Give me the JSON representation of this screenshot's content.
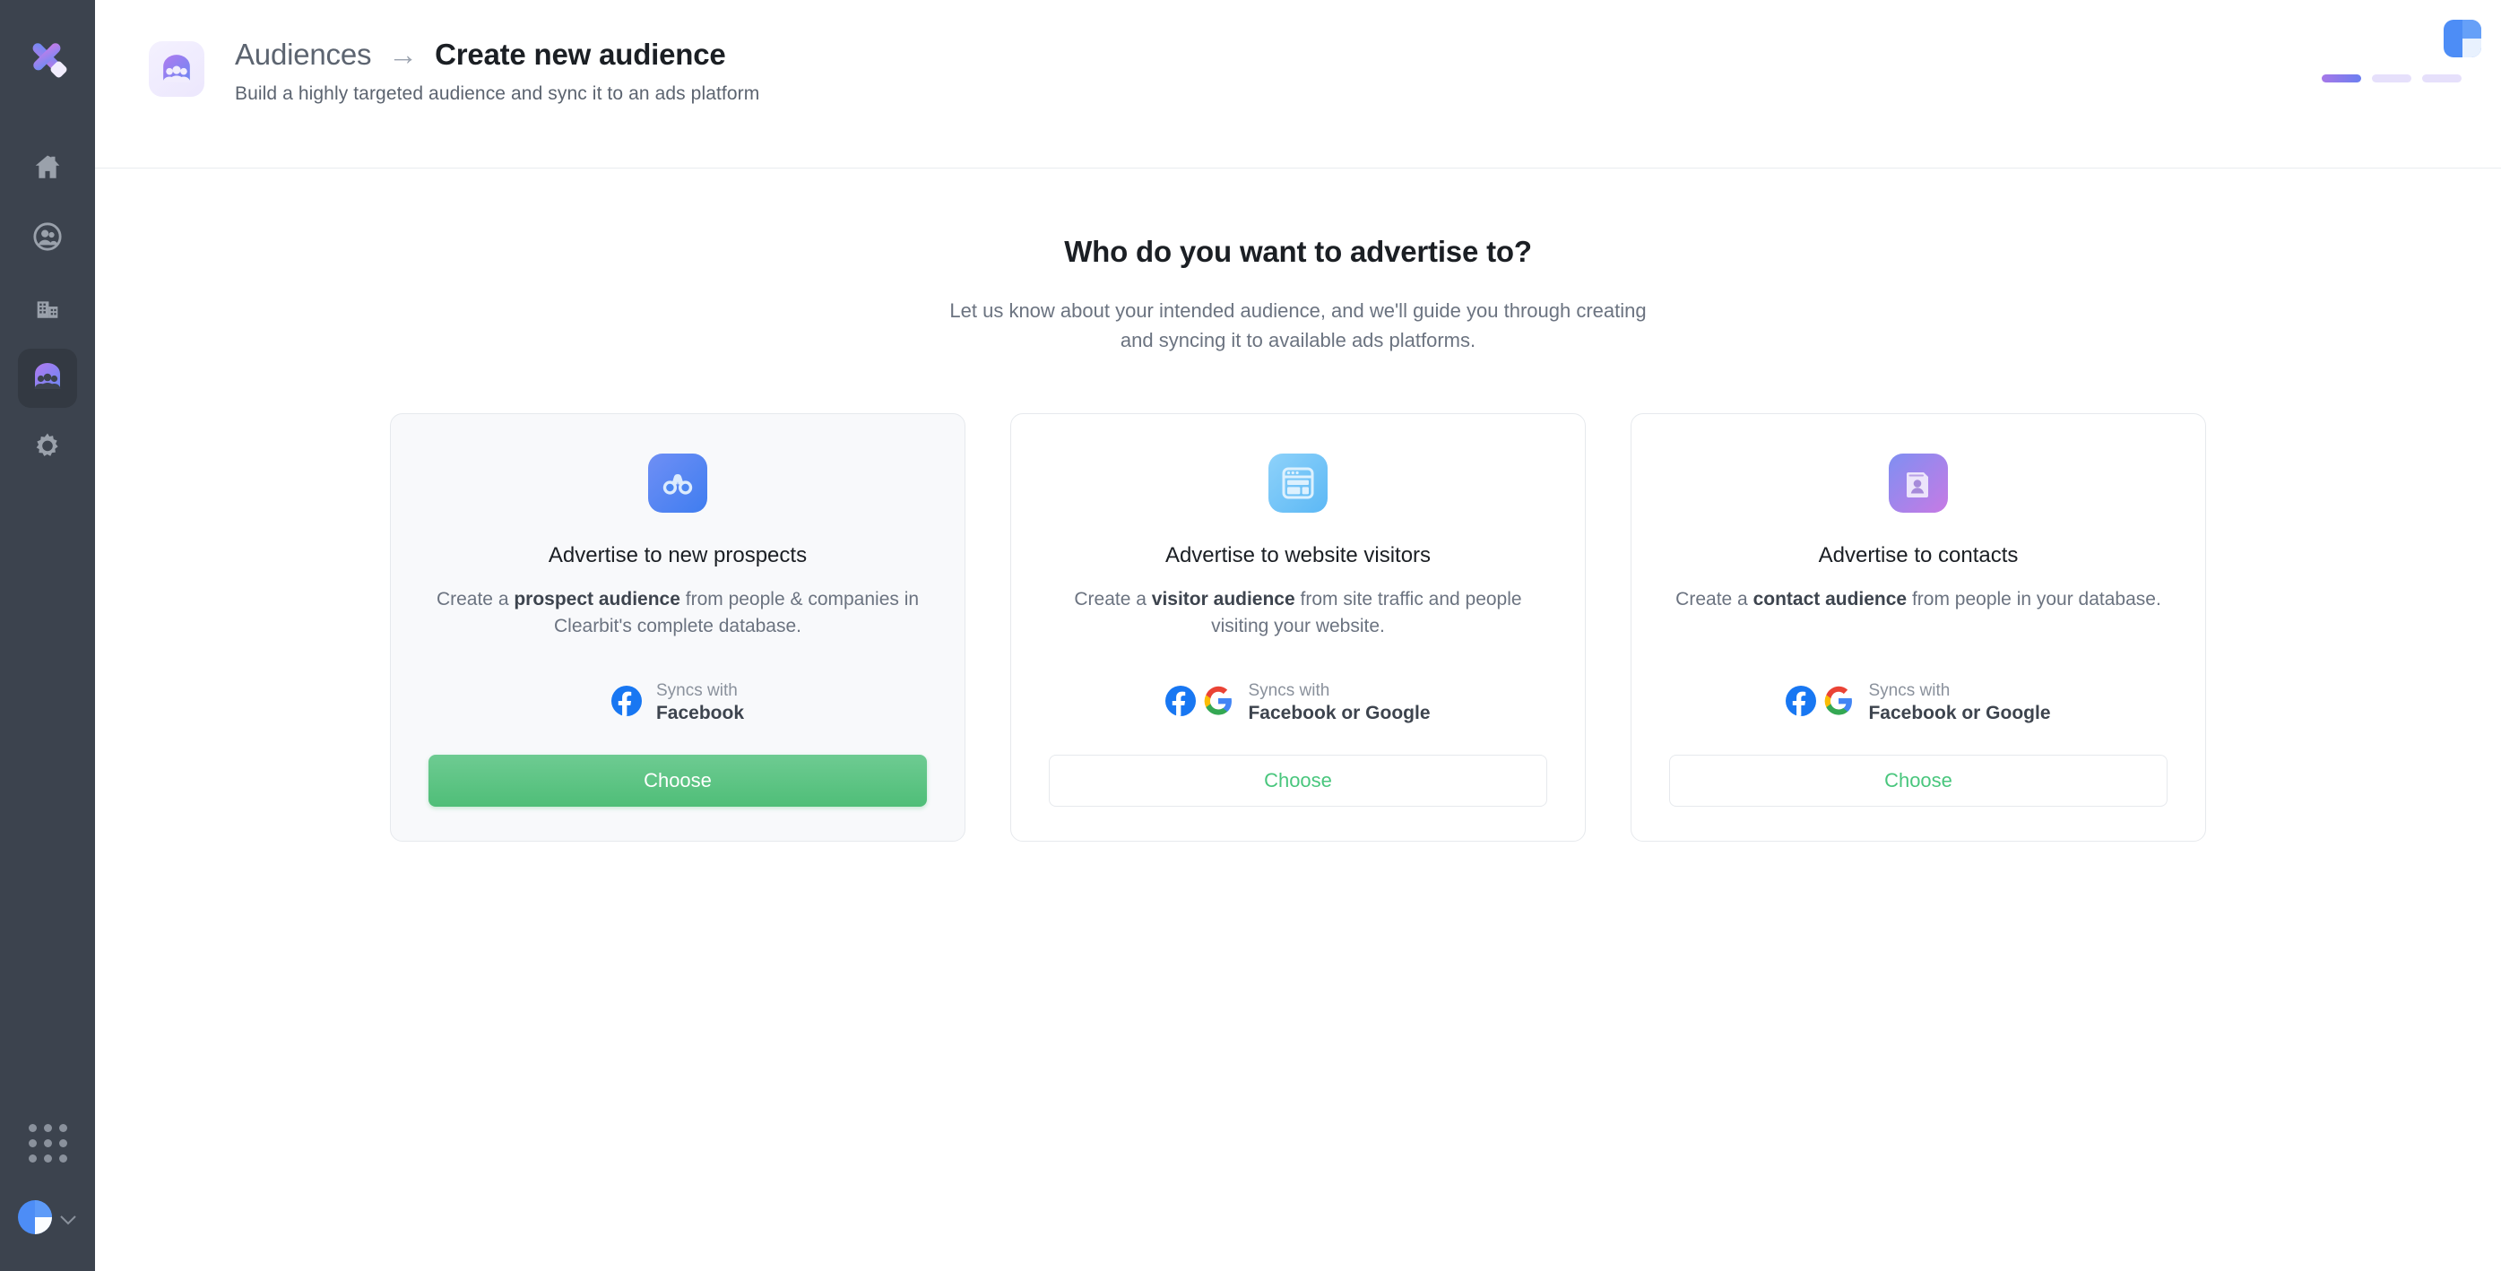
{
  "sidebar": {
    "logo_icon": "clearbit-x-logo",
    "items": [
      {
        "icon": "home-icon",
        "name": "home",
        "active": false
      },
      {
        "icon": "people-icon",
        "name": "people",
        "active": false
      },
      {
        "icon": "building-icon",
        "name": "companies",
        "active": false
      },
      {
        "icon": "audiences-icon",
        "name": "audiences",
        "active": true
      },
      {
        "icon": "gear-icon",
        "name": "settings",
        "active": false
      }
    ],
    "apps_icon": "apps-grid-icon",
    "account_icon": "user-avatar",
    "account_chevron": "chevron-down-icon"
  },
  "header": {
    "page_icon": "audiences-icon",
    "breadcrumb_parent": "Audiences",
    "breadcrumb_separator": "→",
    "breadcrumb_current": "Create new audience",
    "subtitle": "Build a highly targeted audience and sync it to an ads platform",
    "brand_mark": "clearbit-mark-icon",
    "progress": {
      "total": 3,
      "current": 1
    }
  },
  "main": {
    "headline": "Who do you want to advertise to?",
    "subheading": "Let us know about your intended audience, and we'll guide you through creating and syncing it to available ads platforms.",
    "cards": [
      {
        "icon": "binoculars-icon",
        "title": "Advertise to new prospects",
        "desc_pre": "Create a ",
        "desc_bold": "prospect audience",
        "desc_post": " from people & companies in Clearbit's complete database.",
        "sync_label": "Syncs with",
        "sync_platforms": "Facebook",
        "logos": [
          "facebook-logo",
          ""
        ],
        "button_label": "Choose",
        "button_style": "primary"
      },
      {
        "icon": "browser-window-icon",
        "title": "Advertise to website visitors",
        "desc_pre": "Create a ",
        "desc_bold": "visitor audience",
        "desc_post": " from site traffic and people visiting your website.",
        "sync_label": "Syncs with",
        "sync_platforms": "Facebook or Google",
        "logos": [
          "facebook-logo",
          "google-logo"
        ],
        "button_label": "Choose",
        "button_style": "outline"
      },
      {
        "icon": "contact-card-icon",
        "title": "Advertise to contacts",
        "desc_pre": "Create a ",
        "desc_bold": "contact audience",
        "desc_post": " from people in your database.",
        "sync_label": "Syncs with",
        "sync_platforms": "Facebook or Google",
        "logos": [
          "facebook-logo",
          "google-logo"
        ],
        "button_label": "Choose",
        "button_style": "outline"
      }
    ]
  },
  "colors": {
    "sidebar_bg": "#3c434e",
    "accent_purple": "#7c6bf0",
    "primary_green": "#4fbe78",
    "facebook_blue": "#1877f2",
    "text_dark": "#1b1f24",
    "text_muted": "#6b7380"
  }
}
